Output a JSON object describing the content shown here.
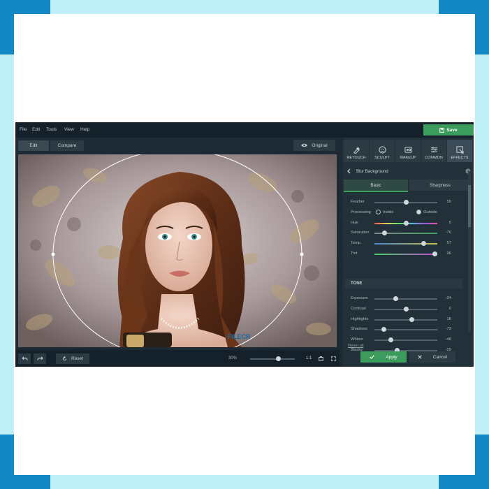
{
  "menu": [
    "File",
    "Edit",
    "Tools",
    "View",
    "Help"
  ],
  "toolbar": {
    "save_label": "Save"
  },
  "view_tabs": {
    "edit": "Edit",
    "compare": "Compare",
    "original": "Original"
  },
  "watermark": "FILECR",
  "bottom": {
    "reset": "Reset",
    "zoom": "30%",
    "ratio": "1:1"
  },
  "zoom_slider_level": 0.62,
  "panel_tabs": [
    "RETOUCH",
    "SCULPT",
    "MAKEUP",
    "COMMON",
    "EFFECTS"
  ],
  "panel": {
    "title": "Blur Background",
    "sub_tabs": [
      "Basic",
      "Sharpness"
    ],
    "processing_label": "Processing",
    "inside": "Inside",
    "outside": "Outside",
    "tone_title": "TONE",
    "reset_all": "Reset all",
    "apply": "Apply",
    "cancel": "Cancel"
  },
  "basic_sliders": [
    {
      "label": "Feather",
      "value": "50",
      "level": 0.5
    },
    {
      "label": "Hue",
      "value": "0",
      "level": 0.5
    },
    {
      "label": "Saturation",
      "value": "-70",
      "level": 0.15
    },
    {
      "label": "Temp",
      "value": "57",
      "level": 0.78
    },
    {
      "label": "Tint",
      "value": "96",
      "level": 0.96
    }
  ],
  "tone_sliders": [
    {
      "label": "Exposure",
      "value": "-34",
      "level": 0.33
    },
    {
      "label": "Contrast",
      "value": "0",
      "level": 0.5
    },
    {
      "label": "Highlights",
      "value": "18",
      "level": 0.59
    },
    {
      "label": "Shadows",
      "value": "-73",
      "level": 0.14
    },
    {
      "label": "Whites",
      "value": "-48",
      "level": 0.26
    },
    {
      "label": "Blacks",
      "value": "-29",
      "level": 0.36
    }
  ],
  "colors": {
    "accent": "#3c9c5c",
    "frame_corner": "#1388c4",
    "bg": "#bfeff7"
  }
}
